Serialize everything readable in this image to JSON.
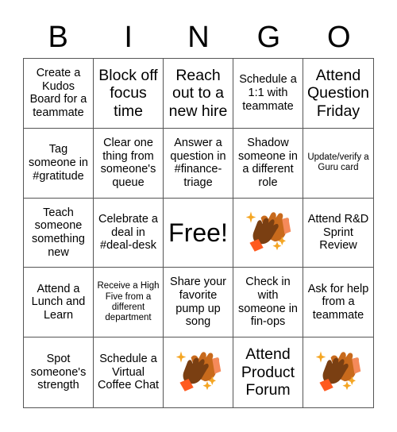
{
  "title_letters": [
    "B",
    "I",
    "N",
    "G",
    "O"
  ],
  "colors": {
    "grid_line": "#555555",
    "hand_dark": "#7a3f12",
    "hand_light": "#c86a1c",
    "cuff": "#ff5a1f",
    "sparkle": "#f5a623"
  },
  "cells": [
    {
      "text": "Create a Kudos Board for a teammate",
      "size": "md"
    },
    {
      "text": "Block off focus time",
      "size": "xl"
    },
    {
      "text": "Reach out to a new hire",
      "size": "xl"
    },
    {
      "text": "Schedule a 1:1 with teammate",
      "size": "md"
    },
    {
      "text": "Attend Question Friday",
      "size": "xl"
    },
    {
      "text": "Tag someone in #gratitude",
      "size": "md"
    },
    {
      "text": "Clear one thing from someone's queue",
      "size": "md"
    },
    {
      "text": "Answer a question in #finance-triage",
      "size": "md"
    },
    {
      "text": "Shadow someone in a different role",
      "size": "md"
    },
    {
      "text": "Update/verify a Guru card",
      "size": "sm"
    },
    {
      "text": "Teach someone something new",
      "size": "md"
    },
    {
      "text": "Celebrate a deal in #deal-desk",
      "size": "md"
    },
    {
      "text": "Free!",
      "size": "free"
    },
    {
      "icon": "clapping-hands-icon"
    },
    {
      "text": "Attend R&D Sprint Review",
      "size": "md"
    },
    {
      "text": "Attend a Lunch and Learn",
      "size": "md"
    },
    {
      "text": "Receive a High Five from a different department",
      "size": "sm"
    },
    {
      "text": "Share your favorite pump up song",
      "size": "md"
    },
    {
      "text": "Check in with someone in fin-ops",
      "size": "md"
    },
    {
      "text": "Ask for help from a teammate",
      "size": "md"
    },
    {
      "text": "Spot someone's strength",
      "size": "md"
    },
    {
      "text": "Schedule a Virtual Coffee Chat",
      "size": "md"
    },
    {
      "icon": "clapping-hands-icon"
    },
    {
      "text": "Attend Product Forum",
      "size": "xl"
    },
    {
      "icon": "clapping-hands-icon"
    }
  ]
}
